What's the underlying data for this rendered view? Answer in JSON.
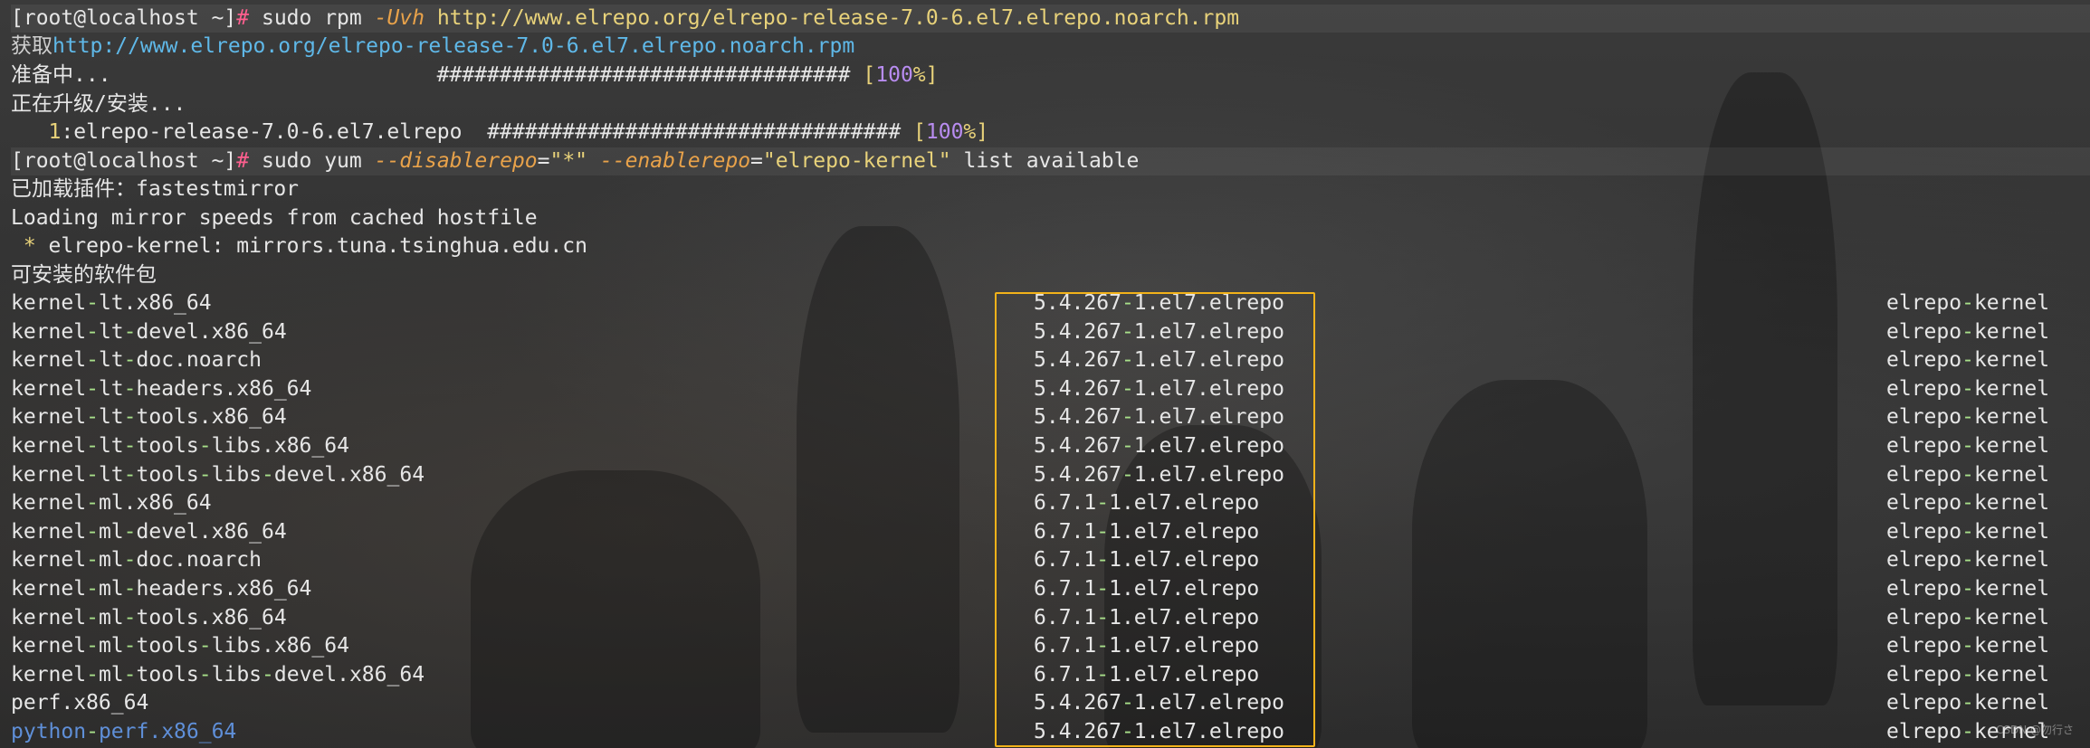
{
  "prompt": "[root@localhost ~]",
  "hash": "#",
  "cmd1": {
    "sudo": "sudo rpm ",
    "opt": "-Uvh",
    "url": " http://www.elrepo.org/elrepo-release-7.0-6.el7.elrepo.noarch.rpm"
  },
  "fetch": {
    "label": "获取",
    "url": "http://www.elrepo.org/elrepo-release-7.0-6.el7.elrepo.noarch.rpm"
  },
  "prep": {
    "label": "准备中...",
    "bar": "                          ################################# ",
    "pct_open": "[",
    "pct": "100",
    "pct_close": "%]"
  },
  "upgrading": "正在升级/安装...",
  "install": {
    "index": "   1",
    "name": ":elrepo-release-7.0-6.el7.elrepo  ",
    "bar": "################################# ",
    "pct_open": "[",
    "pct": "100",
    "pct_close": "%]"
  },
  "cmd2": {
    "sudo": "sudo yum ",
    "opt1": "--disablerepo",
    "eq1": "=",
    "val1": "\"*\"",
    "opt2": "--enablerepo",
    "eq2": "=",
    "val2": "\"elrepo-kernel\"",
    "rest": " list available"
  },
  "plugins": "已加载插件：fastestmirror",
  "mirror_speeds": "Loading mirror speeds from cached hostfile",
  "mirror": {
    "star": " * ",
    "name": "elrepo-kernel",
    "host": ": mirrors.tuna.tsinghua.edu.cn"
  },
  "available_header": "可安装的软件包",
  "packages": [
    {
      "name": "kernel-lt.x86_64",
      "version": "5.4.267-1.el7.elrepo",
      "repo": "elrepo-kernel"
    },
    {
      "name": "kernel-lt-devel.x86_64",
      "version": "5.4.267-1.el7.elrepo",
      "repo": "elrepo-kernel"
    },
    {
      "name": "kernel-lt-doc.noarch",
      "version": "5.4.267-1.el7.elrepo",
      "repo": "elrepo-kernel"
    },
    {
      "name": "kernel-lt-headers.x86_64",
      "version": "5.4.267-1.el7.elrepo",
      "repo": "elrepo-kernel"
    },
    {
      "name": "kernel-lt-tools.x86_64",
      "version": "5.4.267-1.el7.elrepo",
      "repo": "elrepo-kernel"
    },
    {
      "name": "kernel-lt-tools-libs.x86_64",
      "version": "5.4.267-1.el7.elrepo",
      "repo": "elrepo-kernel"
    },
    {
      "name": "kernel-lt-tools-libs-devel.x86_64",
      "version": "5.4.267-1.el7.elrepo",
      "repo": "elrepo-kernel"
    },
    {
      "name": "kernel-ml.x86_64",
      "version": "6.7.1-1.el7.elrepo",
      "repo": "elrepo-kernel"
    },
    {
      "name": "kernel-ml-devel.x86_64",
      "version": "6.7.1-1.el7.elrepo",
      "repo": "elrepo-kernel"
    },
    {
      "name": "kernel-ml-doc.noarch",
      "version": "6.7.1-1.el7.elrepo",
      "repo": "elrepo-kernel"
    },
    {
      "name": "kernel-ml-headers.x86_64",
      "version": "6.7.1-1.el7.elrepo",
      "repo": "elrepo-kernel"
    },
    {
      "name": "kernel-ml-tools.x86_64",
      "version": "6.7.1-1.el7.elrepo",
      "repo": "elrepo-kernel"
    },
    {
      "name": "kernel-ml-tools-libs.x86_64",
      "version": "6.7.1-1.el7.elrepo",
      "repo": "elrepo-kernel"
    },
    {
      "name": "kernel-ml-tools-libs-devel.x86_64",
      "version": "6.7.1-1.el7.elrepo",
      "repo": "elrepo-kernel"
    },
    {
      "name": "perf.x86_64",
      "version": "5.4.267-1.el7.elrepo",
      "repo": "elrepo-kernel"
    },
    {
      "name": "python-perf.x86_64",
      "version": "5.4.267-1.el7.elrepo",
      "repo": "elrepo-kernel"
    }
  ],
  "watermark": "CSDN @勿行さ",
  "colors": {
    "highlight_box": "#f2b21a",
    "prompt_hash": "#ff5f8f",
    "option": "#e8a24a",
    "string": "#e8d27a",
    "link": "#5fb8e8",
    "percent": "#b88cf0"
  }
}
